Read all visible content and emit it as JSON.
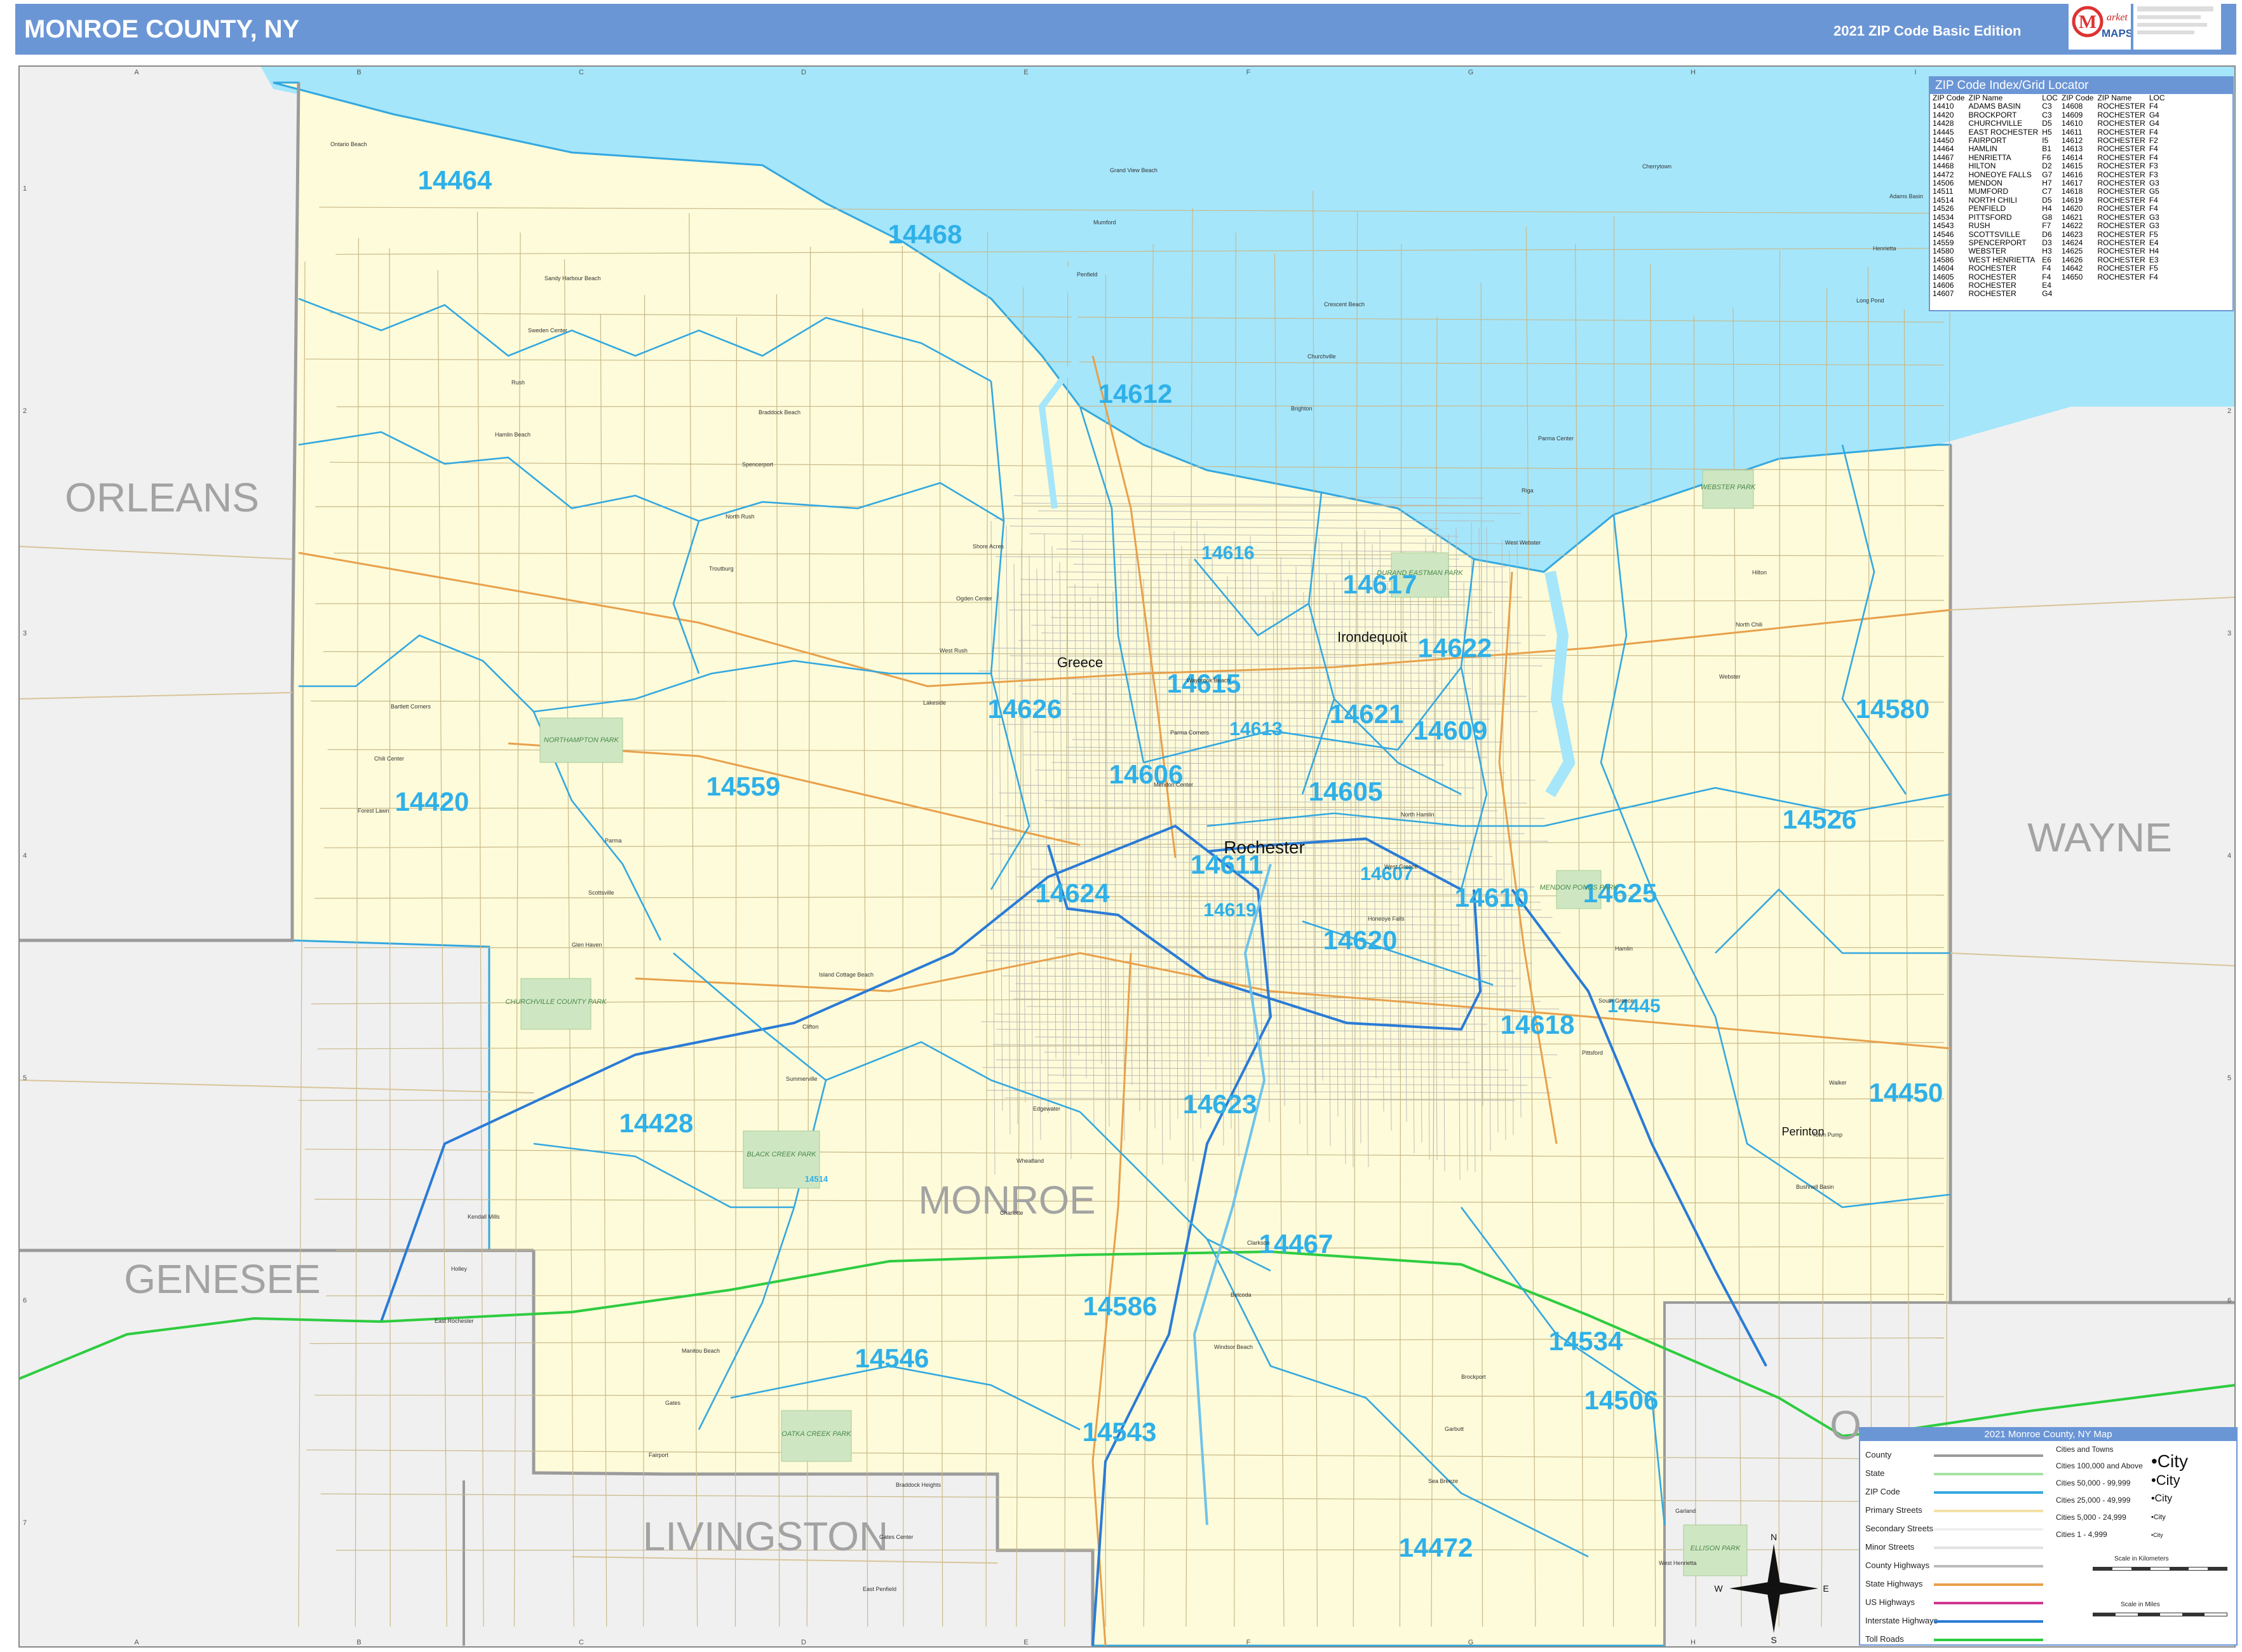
{
  "header": {
    "title": "MONROE COUNTY, NY",
    "edition": "2021 ZIP Code Basic Edition",
    "logo_text": "Market MAPS"
  },
  "colors": {
    "lake": "#a5e6fb",
    "county_fill": "#fdfbd9",
    "outside_fill": "#f0f0f0",
    "zip_boundary": "#33a8e0",
    "county_boundary": "#9b9b9b",
    "interstate": "#2a7bd6",
    "toll_road": "#2ecc40",
    "state_highway": "#e8a04b",
    "header": "#6b96d6",
    "zip_label": "#2fb0e8"
  },
  "grid": {
    "columns": [
      "A",
      "B",
      "C",
      "D",
      "E",
      "F",
      "G",
      "H",
      "I"
    ],
    "rows": [
      "1",
      "2",
      "3",
      "4",
      "5",
      "6",
      "7"
    ]
  },
  "counties": [
    {
      "name": "ORLEANS"
    },
    {
      "name": "WAYNE"
    },
    {
      "name": "GENESEE"
    },
    {
      "name": "LIVINGSTON"
    },
    {
      "name": "MONROE"
    },
    {
      "name": "O"
    }
  ],
  "zip_labels": [
    "14464",
    "14468",
    "14612",
    "14616",
    "14617",
    "14622",
    "14615",
    "14621",
    "14613",
    "14609",
    "14626",
    "14580",
    "14606",
    "14605",
    "14559",
    "14420",
    "14526",
    "14611",
    "14607",
    "14624",
    "14619",
    "14610",
    "14625",
    "14620",
    "14445",
    "14618",
    "14450",
    "14623",
    "14428",
    "14514",
    "14467",
    "14586",
    "14534",
    "14546",
    "14506",
    "14543",
    "14472"
  ],
  "places": {
    "major": [
      "Rochester",
      "Greece",
      "Irondequoit",
      "Perinton"
    ],
    "minor": [
      "Ontario Beach",
      "Sandy Harbour Beach",
      "Braddock Beach",
      "Shore Acres",
      "Waybrook Beach",
      "North Hamlin",
      "Hamlin",
      "Walker",
      "Kendall Mills",
      "Manitou Beach",
      "Braddock Heights",
      "Grand View Beach",
      "Crescent Beach",
      "Parma Center",
      "Hilton",
      "Bartlett Corners",
      "Parma",
      "Island Cottage Beach",
      "Edgewater",
      "Clarkson",
      "Brockport",
      "Garland",
      "Adams Basin",
      "Sweden Center",
      "Spencerport",
      "Ogden Center",
      "Parma Corners",
      "West Greece",
      "South Greece",
      "Town Pump",
      "Holley",
      "Gates",
      "Gates Center",
      "Mumford",
      "Churchville",
      "Riga",
      "North Chili",
      "Chili Center",
      "Scottsville",
      "Clifton",
      "Wheatland",
      "Belcoda",
      "Garbutt",
      "West Henrietta",
      "Henrietta",
      "Rush",
      "North Rush",
      "West Rush",
      "Mendon Center",
      "Honeoye Falls",
      "Pittsford",
      "Bushnell Basin",
      "East Rochester",
      "Fairport",
      "East Penfield",
      "Penfield",
      "Brighton",
      "West Webster",
      "Webster",
      "Forest Lawn",
      "Glen Haven",
      "Summerville",
      "Charlotte",
      "Windsor Beach",
      "Sea Breeze",
      "Cherrytown",
      "Long Pond",
      "Hamlin Beach",
      "Troutburg",
      "Lakeside"
    ],
    "parks": [
      "NORTHAMPTON PARK",
      "CHURCHVILLE COUNTY PARK",
      "BLACK CREEK PARK",
      "OATKA CREEK PARK",
      "DURAND EASTMAN PARK",
      "WEBSTER PARK",
      "MENDON PONDS PARK",
      "ELLISON PARK"
    ]
  },
  "zip_index": {
    "title": "ZIP Code Index/Grid Locator",
    "columns": [
      "ZIP Code",
      "ZIP Name",
      "LOC",
      "ZIP Code",
      "ZIP Name",
      "LOC"
    ],
    "left": [
      [
        "14410",
        "ADAMS BASIN",
        "C3"
      ],
      [
        "14420",
        "BROCKPORT",
        "C3"
      ],
      [
        "14428",
        "CHURCHVILLE",
        "D5"
      ],
      [
        "14445",
        "EAST ROCHESTER",
        "H5"
      ],
      [
        "14450",
        "FAIRPORT",
        "I5"
      ],
      [
        "14464",
        "HAMLIN",
        "B1"
      ],
      [
        "14467",
        "HENRIETTA",
        "F6"
      ],
      [
        "14468",
        "HILTON",
        "D2"
      ],
      [
        "14472",
        "HONEOYE FALLS",
        "G7"
      ],
      [
        "14506",
        "MENDON",
        "H7"
      ],
      [
        "14511",
        "MUMFORD",
        "C7"
      ],
      [
        "14514",
        "NORTH CHILI",
        "D5"
      ],
      [
        "14526",
        "PENFIELD",
        "H4"
      ],
      [
        "14534",
        "PITTSFORD",
        "G8"
      ],
      [
        "14543",
        "RUSH",
        "F7"
      ],
      [
        "14546",
        "SCOTTSVILLE",
        "D6"
      ],
      [
        "14559",
        "SPENCERPORT",
        "D3"
      ],
      [
        "14580",
        "WEBSTER",
        "H3"
      ],
      [
        "14586",
        "WEST HENRIETTA",
        "E6"
      ],
      [
        "14604",
        "ROCHESTER",
        "F4"
      ],
      [
        "14605",
        "ROCHESTER",
        "F4"
      ],
      [
        "14606",
        "ROCHESTER",
        "E4"
      ],
      [
        "14607",
        "ROCHESTER",
        "G4"
      ]
    ],
    "right": [
      [
        "14608",
        "ROCHESTER",
        "F4"
      ],
      [
        "14609",
        "ROCHESTER",
        "G4"
      ],
      [
        "14610",
        "ROCHESTER",
        "G4"
      ],
      [
        "14611",
        "ROCHESTER",
        "F4"
      ],
      [
        "14612",
        "ROCHESTER",
        "F2"
      ],
      [
        "14613",
        "ROCHESTER",
        "F4"
      ],
      [
        "14614",
        "ROCHESTER",
        "F4"
      ],
      [
        "14615",
        "ROCHESTER",
        "F3"
      ],
      [
        "14616",
        "ROCHESTER",
        "F3"
      ],
      [
        "14617",
        "ROCHESTER",
        "G3"
      ],
      [
        "14618",
        "ROCHESTER",
        "G5"
      ],
      [
        "14619",
        "ROCHESTER",
        "F4"
      ],
      [
        "14620",
        "ROCHESTER",
        "F4"
      ],
      [
        "14621",
        "ROCHESTER",
        "G3"
      ],
      [
        "14622",
        "ROCHESTER",
        "G3"
      ],
      [
        "14623",
        "ROCHESTER",
        "F5"
      ],
      [
        "14624",
        "ROCHESTER",
        "E4"
      ],
      [
        "14625",
        "ROCHESTER",
        "H4"
      ],
      [
        "14626",
        "ROCHESTER",
        "E3"
      ],
      [
        "14642",
        "ROCHESTER",
        "F5"
      ],
      [
        "14650",
        "ROCHESTER",
        "F4"
      ]
    ]
  },
  "legend": {
    "title": "2021 Monroe County, NY Map",
    "items": [
      "County",
      "State",
      "ZIP Code",
      "Primary Streets",
      "Secondary Streets",
      "Minor Streets",
      "County Highways",
      "State Highways",
      "US Highways",
      "Interstate Highways",
      "Toll Roads"
    ],
    "cities_header": "Cities and Towns",
    "city_classes": [
      {
        "label": "Cities 100,000 and Above",
        "sample": "•City"
      },
      {
        "label": "Cities 50,000 - 99,999",
        "sample": "•City"
      },
      {
        "label": "Cities 25,000 - 49,999",
        "sample": "•City"
      },
      {
        "label": "Cities 5,000 - 24,999",
        "sample": "•City"
      },
      {
        "label": "Cities 1 - 4,999",
        "sample": "•City"
      }
    ],
    "scale_km": "Scale in Kilometers",
    "scale_mi": "Scale in Miles",
    "compass": [
      "N",
      "E",
      "S",
      "W"
    ]
  }
}
